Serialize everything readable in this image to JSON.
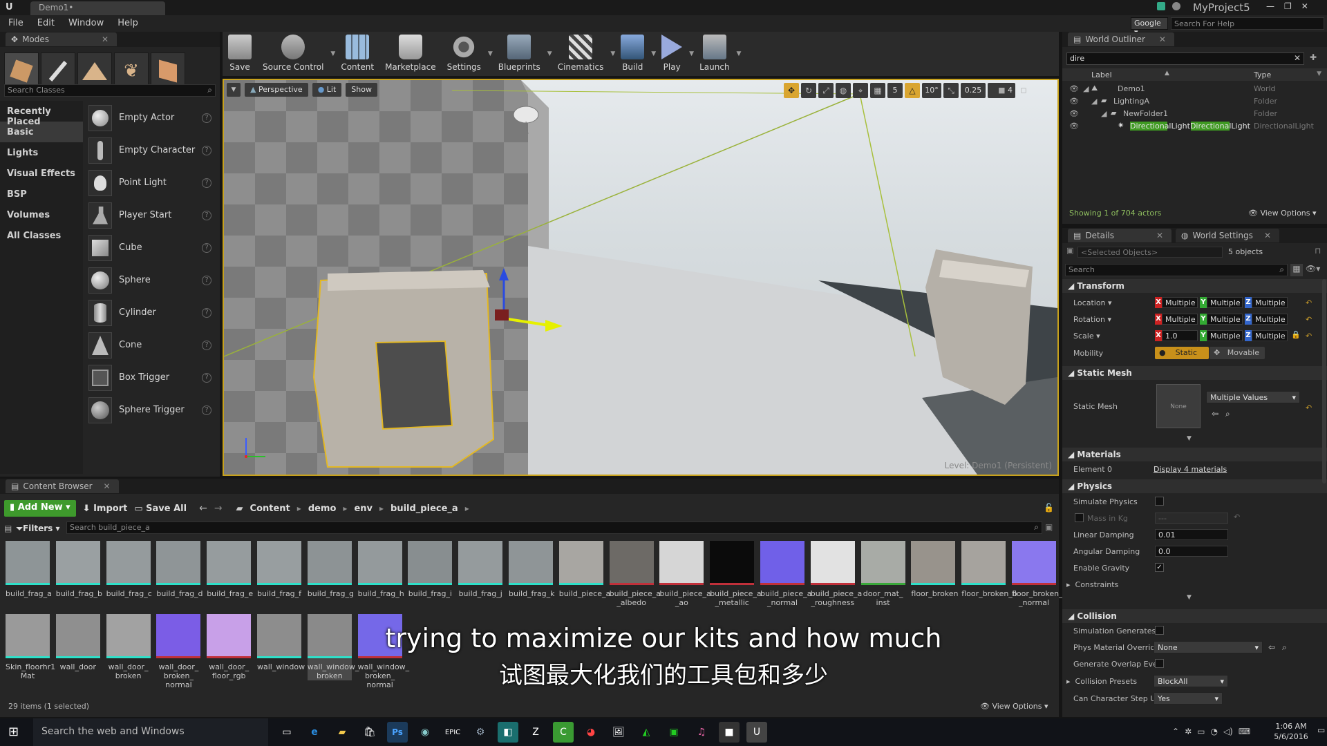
{
  "title_bar": {
    "doc_tab": "Demo1•",
    "project": "MyProject5",
    "search_engine": "Google",
    "search_placeholder": "Search For Help"
  },
  "menu": [
    "File",
    "Edit",
    "Window",
    "Help"
  ],
  "modes": {
    "tab": "Modes",
    "search_placeholder": "Search Classes",
    "categories": [
      "Recently Placed",
      "Basic",
      "Lights",
      "Visual Effects",
      "BSP",
      "Volumes",
      "All Classes"
    ],
    "items": [
      "Empty Actor",
      "Empty Character",
      "Point Light",
      "Player Start",
      "Cube",
      "Sphere",
      "Cylinder",
      "Cone",
      "Box Trigger",
      "Sphere Trigger"
    ]
  },
  "toolbar": [
    "Save",
    "Source Control",
    "Content",
    "Marketplace",
    "Settings",
    "Blueprints",
    "Cinematics",
    "Build",
    "Play",
    "Launch"
  ],
  "viewport": {
    "perspective": "Perspective",
    "lit": "Lit",
    "show": "Show",
    "snap_grid": "5",
    "snap_angle": "10°",
    "snap_scale": "0.25",
    "cam_speed": "4",
    "level_label": "Level:",
    "level_name": "Demo1 (Persistent)"
  },
  "content_browser": {
    "tab": "Content Browser",
    "add_new": "Add New",
    "import": "Import",
    "save_all": "Save All",
    "path": [
      "Content",
      "demo",
      "env",
      "build_piece_a"
    ],
    "filters": "Filters",
    "search_placeholder": "Search build_piece_a",
    "row1": [
      "build_frag_a",
      "build_frag_b",
      "build_frag_c",
      "build_frag_d",
      "build_frag_e",
      "build_frag_f",
      "build_frag_g",
      "build_frag_h",
      "build_frag_i",
      "build_frag_j",
      "build_frag_k",
      "build_piece_a",
      "build_piece_a _albedo",
      "build_piece_a _ao",
      "build_piece_a _metallic",
      "build_piece_a _normal",
      "build_piece_a _roughness",
      "door_mat_ inst",
      "floor_broken",
      "floor_broken_b",
      "floor_broken_b _normal"
    ],
    "row2": [
      "Skin_floorhr1 Mat",
      "wall_door",
      "wall_door_ broken",
      "wall_door_ broken_ normal",
      "wall_door_ floor_rgb",
      "wall_window",
      "wall_window_ broken",
      "wall_window_ broken_ normal"
    ],
    "status": "29 items (1 selected)",
    "view_options": "View Options"
  },
  "subtitles": {
    "en": "trying to maximize our kits and how much",
    "zh": "试图最大化我们的工具包和多少"
  },
  "outliner": {
    "tab": "World Outliner",
    "search_value": "dire",
    "col_label": "Label",
    "col_type": "Type",
    "rows": [
      {
        "label": "Demo1",
        "type": "World"
      },
      {
        "label": "LightingA",
        "type": "Folder"
      },
      {
        "label": "NewFolder1",
        "type": "Folder"
      },
      {
        "label": "DirectionalLightDirectionalLight",
        "type": "DirectionalLight"
      }
    ],
    "status": "Showing 1 of 704 actors",
    "view_options": "View Options"
  },
  "details": {
    "tab_details": "Details",
    "tab_world": "World Settings",
    "selected": "<Selected Objects>",
    "count": "5 objects",
    "search_placeholder": "Search",
    "transform": "Transform",
    "location": "Location",
    "rotation": "Rotation",
    "scale": "Scale",
    "multiple": "Multiple",
    "scale_x": "1.0",
    "mobility": "Mobility",
    "static": "Static",
    "movable": "Movable",
    "static_mesh_section": "Static Mesh",
    "static_mesh_label": "Static Mesh",
    "mesh_none": "None",
    "mesh_value": "Multiple Values",
    "materials": "Materials",
    "element0": "Element 0",
    "display_materials": "Display 4 materials",
    "physics": "Physics",
    "simulate": "Simulate Physics",
    "mass": "Mass in Kg",
    "linear": "Linear Damping",
    "linear_val": "0.01",
    "angular": "Angular Damping",
    "angular_val": "0.0",
    "gravity": "Enable Gravity",
    "constraints": "Constraints",
    "collision": "Collision",
    "sim_gen": "Simulation Generates",
    "phys_mat": "Phys Material Overrid",
    "phys_mat_val": "None",
    "overlap": "Generate Overlap Eve",
    "presets": "Collision Presets",
    "presets_val": "BlockAll",
    "step": "Can Character Step U",
    "step_val": "Yes"
  },
  "taskbar": {
    "search": "Search the web and Windows",
    "time": "1:06 AM",
    "date": "5/6/2016"
  }
}
